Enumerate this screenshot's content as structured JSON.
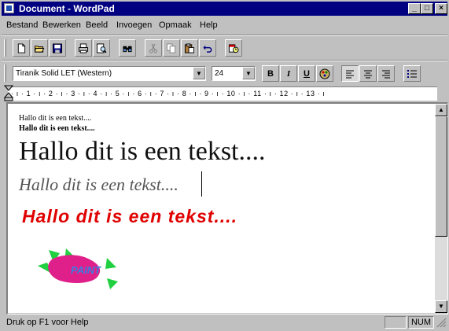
{
  "window": {
    "title": "Document - WordPad",
    "controls": {
      "minimize": "_",
      "maximize": "□",
      "close": "×"
    }
  },
  "menu": [
    "Bestand",
    "Bewerken",
    "Beeld",
    "Invoegen",
    "Opmaak",
    "Help"
  ],
  "toolbar": {
    "icons": [
      "new-document-icon",
      "open-folder-icon",
      "save-icon",
      "print-icon",
      "print-preview-icon",
      "find-icon",
      "cut-icon",
      "copy-icon",
      "paste-icon",
      "undo-icon",
      "date-time-icon"
    ]
  },
  "format_bar": {
    "font": "Tiranik Solid LET (Western)",
    "size": "24",
    "bold": "B",
    "italic": "I",
    "underline": "U",
    "icons": [
      "color-icon",
      "align-left-icon",
      "align-center-icon",
      "align-right-icon",
      "bullets-icon"
    ]
  },
  "ruler": {
    "marks": "· ı · 1 · ı · 2 · ı · 3 · ı · 4 · ı · 5 · ı · 6 · ı · 7 · ı · 8 · ı · 9 · ı · 10 · ı · 11 · ı · 12 · ı · 13 · ı"
  },
  "document": {
    "lines": [
      "Hallo dit is een tekst....",
      "Hallo dit is een tekst....",
      "Hallo dit is een tekst....",
      "Hallo dit is een tekst....",
      "Hallo dit is een tekst...."
    ],
    "embedded_object_label": "PAINT"
  },
  "status": {
    "help_text": "Druk op F1 voor Help",
    "num": "NUM"
  }
}
